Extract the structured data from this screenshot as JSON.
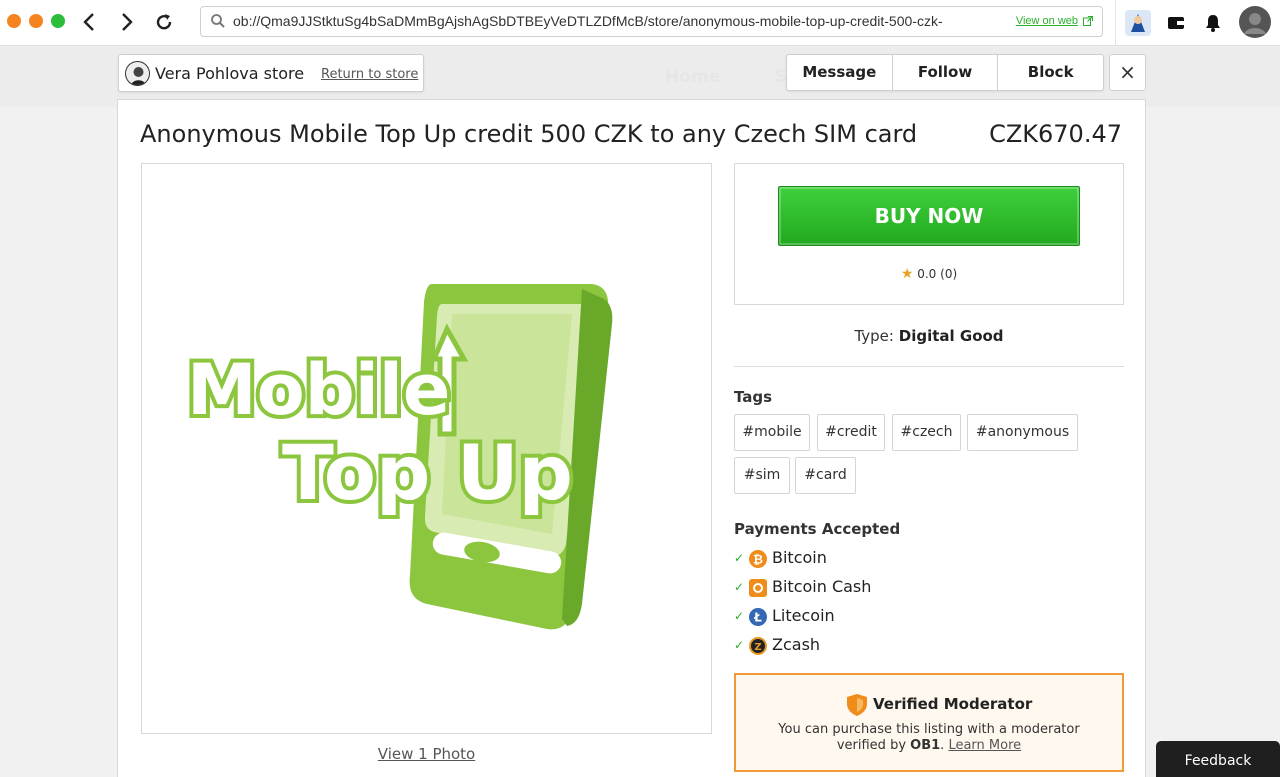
{
  "browser": {
    "url": "ob://Qma9JJStktuSg4bSaDMmBgAjshAgSbDTBEyVeDTLZDfMcB/store/anonymous-mobile-top-up-credit-500-czk-",
    "view_on_web": "View on web"
  },
  "background_nav": [
    "Home",
    "S"
  ],
  "store": {
    "name": "Vera Pohlova store",
    "return_label": "Return to store"
  },
  "actions": {
    "message": "Message",
    "follow": "Follow",
    "block": "Block",
    "close": "×"
  },
  "listing": {
    "title": "Anonymous Mobile Top Up credit 500 CZK to any Czech SIM card",
    "price": "CZK670.47",
    "view_photos": "View 1 Photo",
    "image_text": {
      "line1": "Mobile",
      "line2": "Top Up"
    }
  },
  "buy": {
    "label": "BUY NOW",
    "rating": "0.0 (0)"
  },
  "type": {
    "label": "Type:",
    "value": "Digital Good"
  },
  "tags": {
    "heading": "Tags",
    "items": [
      "#mobile",
      "#credit",
      "#czech",
      "#anonymous",
      "#sim",
      "#card"
    ]
  },
  "payments": {
    "heading": "Payments Accepted",
    "items": [
      {
        "name": "Bitcoin",
        "icon": "bitcoin-icon",
        "color": "#f08c1a"
      },
      {
        "name": "Bitcoin Cash",
        "icon": "bitcoin-cash-icon",
        "color": "#f08c1a"
      },
      {
        "name": "Litecoin",
        "icon": "litecoin-icon",
        "color": "#3468b2"
      },
      {
        "name": "Zcash",
        "icon": "zcash-icon",
        "color": "#e89a2b"
      }
    ]
  },
  "moderator": {
    "title": "Verified Moderator",
    "line1": "You can purchase this listing with a moderator",
    "line2_pre": "verified by",
    "line2_bold": "OB1",
    "learn_more": "Learn More"
  },
  "feedback": "Feedback",
  "colors": {
    "accent_green": "#2bae2b",
    "buy_green": "#22a91f",
    "moderator_orange": "#f09a3a",
    "logo_green": "#8cc63f"
  }
}
